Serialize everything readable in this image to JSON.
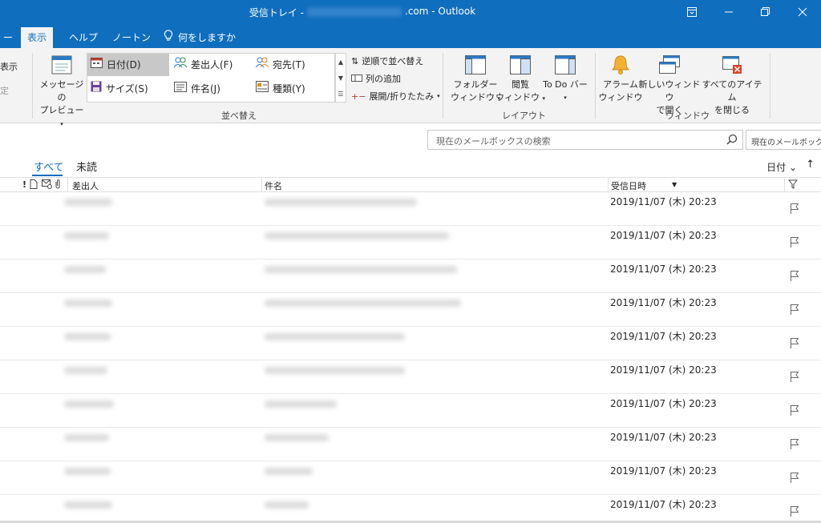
{
  "window": {
    "title_prefix": "受信トレイ -",
    "title_suffix": ".com  -  Outlook"
  },
  "tabs": [
    {
      "label": "ー"
    },
    {
      "label": "表示"
    },
    {
      "label": "ヘルプ"
    },
    {
      "label": "ノートン"
    },
    {
      "label": "何をしますか"
    }
  ],
  "ribbon": {
    "partial_view_label": "表示",
    "partial_reset_label": "定",
    "preview": {
      "line1": "メッセージの",
      "line2": "プレビュー"
    },
    "arrangement": {
      "items": [
        {
          "label": "日付(D)",
          "selected": true
        },
        {
          "label": "差出人(F)",
          "selected": false
        },
        {
          "label": "宛先(T)",
          "selected": false
        },
        {
          "label": "サイズ(S)",
          "selected": false
        },
        {
          "label": "件名(J)",
          "selected": false
        },
        {
          "label": "種類(Y)",
          "selected": false
        }
      ],
      "group_label": "並べ替え"
    },
    "small_commands": {
      "reverse_sort": "逆順で並べ替え",
      "add_columns": "列の追加",
      "expand_collapse": "展開/折りたたみ"
    },
    "layout": {
      "folder_pane": {
        "line1": "フォルダー",
        "line2": "ウィンドウ"
      },
      "reading_pane": {
        "line1": "閲覧",
        "line2": "ウィンドウ"
      },
      "todo_bar": {
        "line1": "To Do バー"
      },
      "group_label": "レイアウト"
    },
    "window_group": {
      "reminders": {
        "line1": "アラーム",
        "line2": "ウィンドウ"
      },
      "open_new": {
        "line1": "新しいウィンドウ",
        "line2": "で開く"
      },
      "close_all": {
        "line1": "すべてのアイテム",
        "line2": "を閉じる"
      },
      "group_label": "ウィンドウ"
    }
  },
  "search": {
    "placeholder": "現在のメールボックスの検索",
    "scope": "現在のメールボックス"
  },
  "filters": {
    "all": "すべて",
    "unread": "未読",
    "sort_by": "日付",
    "sort_dir_icon": "up-arrow"
  },
  "columns": {
    "importance": "!",
    "from": "差出人",
    "subject": "件名",
    "received": "受信日時"
  },
  "messages": [
    {
      "received": "2019/11/07 (木) 20:23"
    },
    {
      "received": "2019/11/07 (木) 20:23"
    },
    {
      "received": "2019/11/07 (木) 20:23"
    },
    {
      "received": "2019/11/07 (木) 20:23"
    },
    {
      "received": "2019/11/07 (木) 20:23"
    },
    {
      "received": "2019/11/07 (木) 20:23"
    },
    {
      "received": "2019/11/07 (木) 20:23"
    },
    {
      "received": "2019/11/07 (木) 20:23"
    },
    {
      "received": "2019/11/07 (木) 20:23"
    },
    {
      "received": "2019/11/07 (木) 20:23"
    }
  ],
  "colors": {
    "accent": "#106ebe",
    "ribbon_bg": "#f3f3f3",
    "selected_gallery": "#c8c8c8"
  }
}
